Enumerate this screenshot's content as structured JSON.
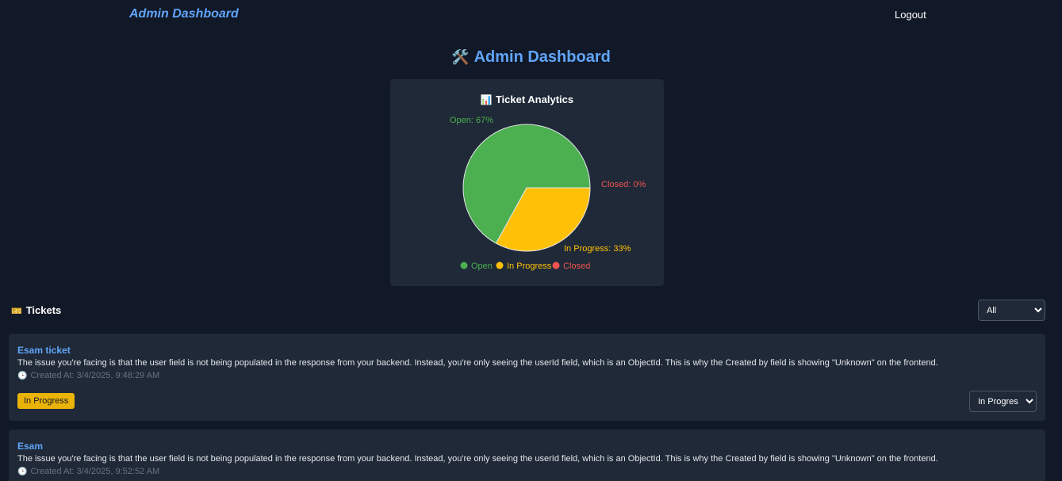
{
  "nav": {
    "brand": "Admin Dashboard",
    "logout": "Logout"
  },
  "page": {
    "icon": "🛠️",
    "title": "Admin Dashboard"
  },
  "analytics": {
    "icon": "📊",
    "title": "Ticket Analytics"
  },
  "chart_data": {
    "type": "pie",
    "title": "Ticket Analytics",
    "slices": [
      {
        "label": "Open",
        "value": 67,
        "color": "#4caf50",
        "data_label": "Open: 67%",
        "label_color": "#4caf50"
      },
      {
        "label": "In Progress",
        "value": 33,
        "color": "#ffc107",
        "data_label": "In Progress: 33%",
        "label_color": "#ffc107"
      },
      {
        "label": "Closed",
        "value": 0,
        "color": "#ef5350",
        "data_label": "Closed: 0%",
        "label_color": "#ef5350"
      }
    ],
    "legend": [
      "Open",
      "In Progress",
      "Closed"
    ],
    "legend_placement": "bottom"
  },
  "tickets_section": {
    "icon": "🎫",
    "title": "Tickets",
    "filter_value": "All"
  },
  "tickets": [
    {
      "title": "Esam ticket",
      "description": "The issue you're facing is that the user field is not being populated in the response from your backend. Instead, you're only seeing the userId field, which is an ObjectId. This is why the Created by field is showing \"Unknown\" on the frontend.",
      "clock_icon": "🕒",
      "created": "Created At: 3/4/2025, 9:48:29 AM",
      "status": "In Progress",
      "status_select": "In Progress"
    },
    {
      "title": "Esam",
      "description": "The issue you're facing is that the user field is not being populated in the response from your backend. Instead, you're only seeing the userId field, which is an ObjectId. This is why the Created by field is showing \"Unknown\" on the frontend.",
      "clock_icon": "🕒",
      "created": "Created At: 3/4/2025, 9:52:52 AM"
    }
  ]
}
